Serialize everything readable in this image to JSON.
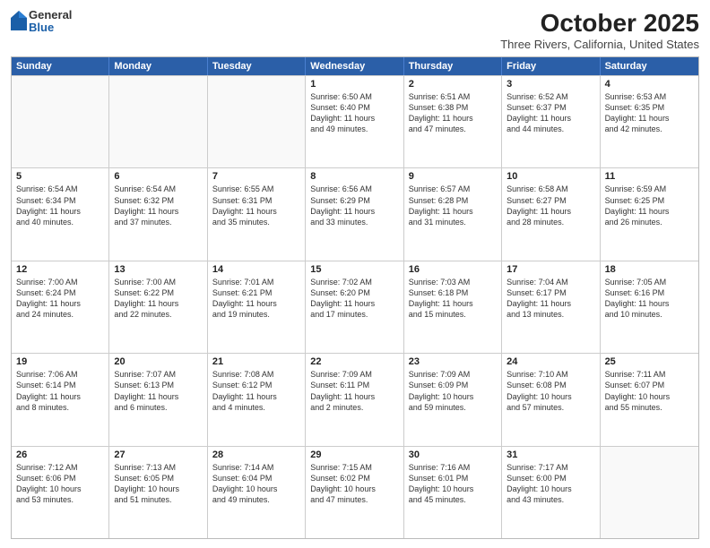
{
  "logo": {
    "general": "General",
    "blue": "Blue"
  },
  "title": "October 2025",
  "location": "Three Rivers, California, United States",
  "header_days": [
    "Sunday",
    "Monday",
    "Tuesday",
    "Wednesday",
    "Thursday",
    "Friday",
    "Saturday"
  ],
  "weeks": [
    [
      {
        "day": "",
        "info": ""
      },
      {
        "day": "",
        "info": ""
      },
      {
        "day": "",
        "info": ""
      },
      {
        "day": "1",
        "info": "Sunrise: 6:50 AM\nSunset: 6:40 PM\nDaylight: 11 hours\nand 49 minutes."
      },
      {
        "day": "2",
        "info": "Sunrise: 6:51 AM\nSunset: 6:38 PM\nDaylight: 11 hours\nand 47 minutes."
      },
      {
        "day": "3",
        "info": "Sunrise: 6:52 AM\nSunset: 6:37 PM\nDaylight: 11 hours\nand 44 minutes."
      },
      {
        "day": "4",
        "info": "Sunrise: 6:53 AM\nSunset: 6:35 PM\nDaylight: 11 hours\nand 42 minutes."
      }
    ],
    [
      {
        "day": "5",
        "info": "Sunrise: 6:54 AM\nSunset: 6:34 PM\nDaylight: 11 hours\nand 40 minutes."
      },
      {
        "day": "6",
        "info": "Sunrise: 6:54 AM\nSunset: 6:32 PM\nDaylight: 11 hours\nand 37 minutes."
      },
      {
        "day": "7",
        "info": "Sunrise: 6:55 AM\nSunset: 6:31 PM\nDaylight: 11 hours\nand 35 minutes."
      },
      {
        "day": "8",
        "info": "Sunrise: 6:56 AM\nSunset: 6:29 PM\nDaylight: 11 hours\nand 33 minutes."
      },
      {
        "day": "9",
        "info": "Sunrise: 6:57 AM\nSunset: 6:28 PM\nDaylight: 11 hours\nand 31 minutes."
      },
      {
        "day": "10",
        "info": "Sunrise: 6:58 AM\nSunset: 6:27 PM\nDaylight: 11 hours\nand 28 minutes."
      },
      {
        "day": "11",
        "info": "Sunrise: 6:59 AM\nSunset: 6:25 PM\nDaylight: 11 hours\nand 26 minutes."
      }
    ],
    [
      {
        "day": "12",
        "info": "Sunrise: 7:00 AM\nSunset: 6:24 PM\nDaylight: 11 hours\nand 24 minutes."
      },
      {
        "day": "13",
        "info": "Sunrise: 7:00 AM\nSunset: 6:22 PM\nDaylight: 11 hours\nand 22 minutes."
      },
      {
        "day": "14",
        "info": "Sunrise: 7:01 AM\nSunset: 6:21 PM\nDaylight: 11 hours\nand 19 minutes."
      },
      {
        "day": "15",
        "info": "Sunrise: 7:02 AM\nSunset: 6:20 PM\nDaylight: 11 hours\nand 17 minutes."
      },
      {
        "day": "16",
        "info": "Sunrise: 7:03 AM\nSunset: 6:18 PM\nDaylight: 11 hours\nand 15 minutes."
      },
      {
        "day": "17",
        "info": "Sunrise: 7:04 AM\nSunset: 6:17 PM\nDaylight: 11 hours\nand 13 minutes."
      },
      {
        "day": "18",
        "info": "Sunrise: 7:05 AM\nSunset: 6:16 PM\nDaylight: 11 hours\nand 10 minutes."
      }
    ],
    [
      {
        "day": "19",
        "info": "Sunrise: 7:06 AM\nSunset: 6:14 PM\nDaylight: 11 hours\nand 8 minutes."
      },
      {
        "day": "20",
        "info": "Sunrise: 7:07 AM\nSunset: 6:13 PM\nDaylight: 11 hours\nand 6 minutes."
      },
      {
        "day": "21",
        "info": "Sunrise: 7:08 AM\nSunset: 6:12 PM\nDaylight: 11 hours\nand 4 minutes."
      },
      {
        "day": "22",
        "info": "Sunrise: 7:09 AM\nSunset: 6:11 PM\nDaylight: 11 hours\nand 2 minutes."
      },
      {
        "day": "23",
        "info": "Sunrise: 7:09 AM\nSunset: 6:09 PM\nDaylight: 10 hours\nand 59 minutes."
      },
      {
        "day": "24",
        "info": "Sunrise: 7:10 AM\nSunset: 6:08 PM\nDaylight: 10 hours\nand 57 minutes."
      },
      {
        "day": "25",
        "info": "Sunrise: 7:11 AM\nSunset: 6:07 PM\nDaylight: 10 hours\nand 55 minutes."
      }
    ],
    [
      {
        "day": "26",
        "info": "Sunrise: 7:12 AM\nSunset: 6:06 PM\nDaylight: 10 hours\nand 53 minutes."
      },
      {
        "day": "27",
        "info": "Sunrise: 7:13 AM\nSunset: 6:05 PM\nDaylight: 10 hours\nand 51 minutes."
      },
      {
        "day": "28",
        "info": "Sunrise: 7:14 AM\nSunset: 6:04 PM\nDaylight: 10 hours\nand 49 minutes."
      },
      {
        "day": "29",
        "info": "Sunrise: 7:15 AM\nSunset: 6:02 PM\nDaylight: 10 hours\nand 47 minutes."
      },
      {
        "day": "30",
        "info": "Sunrise: 7:16 AM\nSunset: 6:01 PM\nDaylight: 10 hours\nand 45 minutes."
      },
      {
        "day": "31",
        "info": "Sunrise: 7:17 AM\nSunset: 6:00 PM\nDaylight: 10 hours\nand 43 minutes."
      },
      {
        "day": "",
        "info": ""
      }
    ]
  ]
}
